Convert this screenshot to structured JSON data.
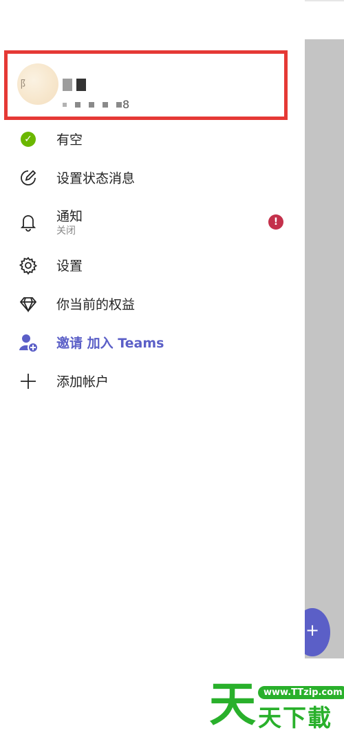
{
  "profile": {
    "avatar_initial": "阝",
    "phone_suffix": "8"
  },
  "menu": {
    "status": {
      "label": "有空",
      "icon": "available-check-icon",
      "color": "#6bb700"
    },
    "set_status_message": {
      "label": "设置状态消息",
      "icon": "edit-status-icon"
    },
    "notifications": {
      "label": "通知",
      "sublabel": "关闭",
      "icon": "bell-icon",
      "alert": "!",
      "alert_color": "#c4314b"
    },
    "settings": {
      "label": "设置",
      "icon": "gear-icon"
    },
    "benefits": {
      "label": "你当前的权益",
      "icon": "diamond-icon"
    },
    "invite": {
      "label": "邀请 加入 Teams",
      "icon": "add-person-icon",
      "color": "#5b5fc7"
    },
    "add_account": {
      "label": "添加帐户",
      "icon": "plus-icon"
    }
  },
  "fab": {
    "label": "+",
    "icon": "compose-icon",
    "color": "#5b5fc7"
  },
  "watermark": {
    "big_char": "天",
    "url": "www.TTzip.com",
    "text": "天下載",
    "color": "#29b02b"
  },
  "highlight_color": "#e53935"
}
